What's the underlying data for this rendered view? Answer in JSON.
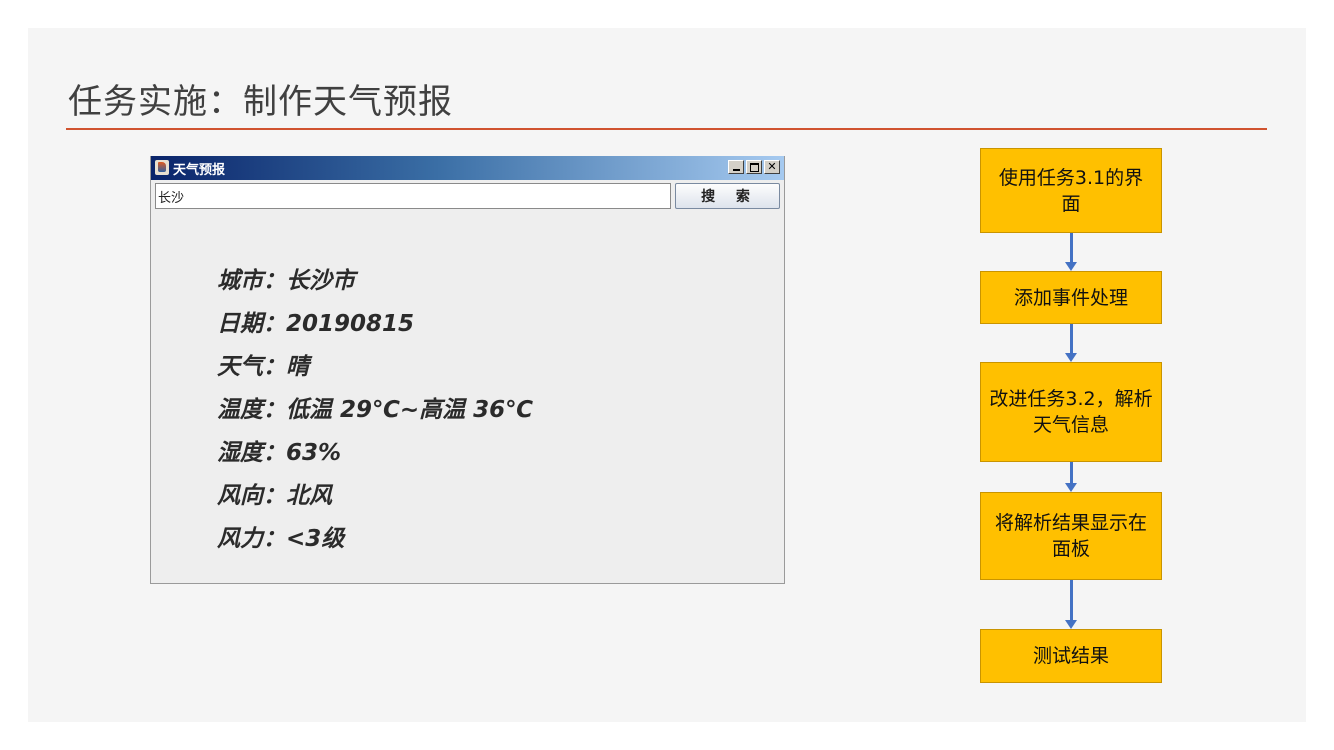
{
  "slide": {
    "title": "任务实施：制作天气预报"
  },
  "window": {
    "title": "天气预报",
    "search": {
      "value": "长沙",
      "button_label": "搜 索"
    },
    "info": [
      "城市：长沙市",
      "日期：20190815",
      "天气：晴",
      "温度：低温 29℃~高温 36℃",
      "湿度：63%",
      "风向：北风",
      "风力：<3级"
    ]
  },
  "flowchart": {
    "steps": [
      "使用任务3.1的界面",
      "添加事件处理",
      "改进任务3.2，解析天气信息",
      "将解析结果显示在面板",
      "测试结果"
    ]
  },
  "colors": {
    "title_rule": "#d0532f",
    "flow_box": "#ffc000",
    "flow_arrow": "#4472c4"
  }
}
